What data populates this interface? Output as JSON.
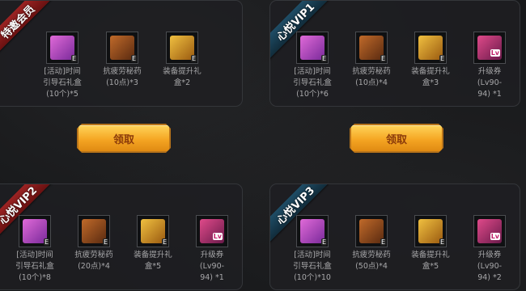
{
  "panels": [
    {
      "ribbon": "特邀会员",
      "ribbon_color": "#7a1a1a",
      "items": [
        {
          "icon": "gift-icon",
          "label": "[活动]时间\n引导石礼盒\n(10个)*5"
        },
        {
          "icon": "potion-icon",
          "label": "抗疲劳秘药\n(10点)*3"
        },
        {
          "icon": "box-icon",
          "label": "装备提升礼\n盒*2"
        }
      ]
    },
    {
      "ribbon": "心悦VIP1",
      "ribbon_color": "#153a4d",
      "items": [
        {
          "icon": "gift-icon",
          "label": "[活动]时间\n引导石礼盒\n(10个)*6"
        },
        {
          "icon": "potion-icon",
          "label": "抗疲劳秘药\n(10点)*4"
        },
        {
          "icon": "box-icon",
          "label": "装备提升礼\n盒*3"
        },
        {
          "icon": "ticket-icon",
          "label": "升级券\n(Lv90-\n94) *1"
        }
      ]
    },
    {
      "ribbon": "心悦VIP2",
      "ribbon_color": "#7a1a1a",
      "items": [
        {
          "icon": "gift-icon",
          "label": "[活动]时间\n引导石礼盒\n(10个)*8"
        },
        {
          "icon": "potion-icon",
          "label": "抗疲劳秘药\n(20点)*4"
        },
        {
          "icon": "box-icon",
          "label": "装备提升礼\n盒*5"
        },
        {
          "icon": "ticket-icon",
          "label": "升级券\n(Lv90-\n94) *1"
        }
      ]
    },
    {
      "ribbon": "心悦VIP3",
      "ribbon_color": "#153a4d",
      "items": [
        {
          "icon": "gift-icon",
          "label": "[活动]时间\n引导石礼盒\n(10个)*10"
        },
        {
          "icon": "potion-icon",
          "label": "抗疲劳秘药\n(50点)*4"
        },
        {
          "icon": "box-icon",
          "label": "装备提升礼\n盒*5"
        },
        {
          "icon": "ticket-icon",
          "label": "升级券\n(Lv90-\n94) *2"
        }
      ]
    }
  ],
  "claim_buttons": [
    "领取",
    "领取"
  ],
  "tag_text": {
    "e": "E",
    "lv": "Lv"
  }
}
